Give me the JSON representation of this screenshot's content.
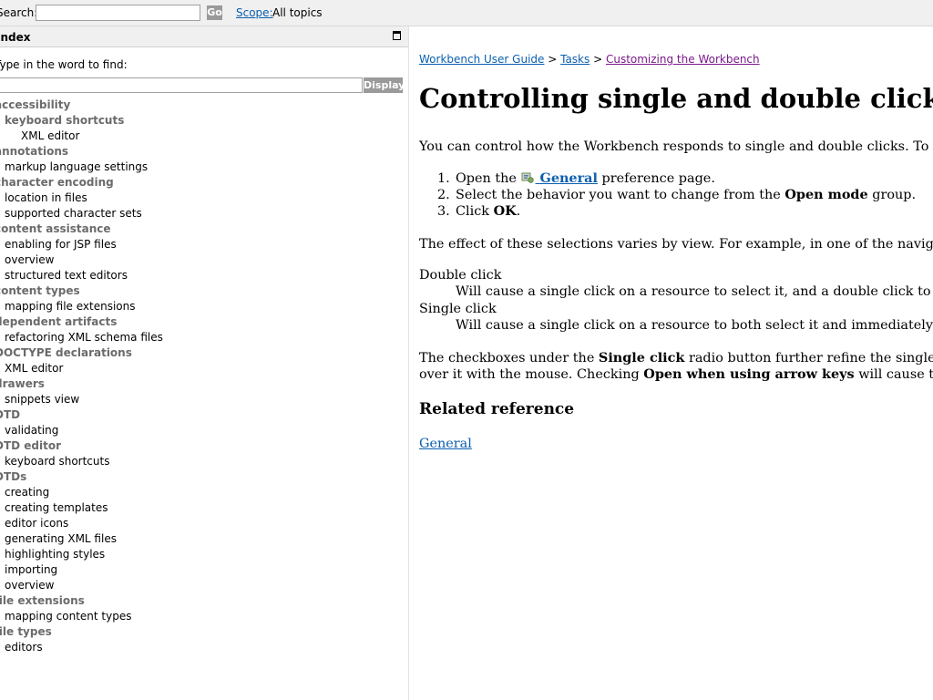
{
  "topbar": {
    "search_label": "Search:",
    "search_value": "",
    "go_label": "Go",
    "scope_link": "Scope:",
    "scope_value": "All topics"
  },
  "index": {
    "title": "Index",
    "find_label": "Type in the word to find:",
    "find_value": "",
    "display_label": "Display",
    "items": [
      {
        "text": "accessibility",
        "level": 0
      },
      {
        "text": "keyboard shortcuts",
        "level": 1,
        "bold": true
      },
      {
        "text": "XML editor",
        "level": 2
      },
      {
        "text": "annotations",
        "level": 0
      },
      {
        "text": "markup language settings",
        "level": 1
      },
      {
        "text": "character encoding",
        "level": 0
      },
      {
        "text": "location in files",
        "level": 1
      },
      {
        "text": "supported character sets",
        "level": 1
      },
      {
        "text": "content assistance",
        "level": 0
      },
      {
        "text": "enabling for JSP files",
        "level": 1
      },
      {
        "text": "overview",
        "level": 1
      },
      {
        "text": "structured text editors",
        "level": 1
      },
      {
        "text": "content types",
        "level": 0
      },
      {
        "text": "mapping file extensions",
        "level": 1
      },
      {
        "text": "dependent artifacts",
        "level": 0
      },
      {
        "text": "refactoring XML schema files",
        "level": 1
      },
      {
        "text": "DOCTYPE declarations",
        "level": 0
      },
      {
        "text": "XML editor",
        "level": 1
      },
      {
        "text": "drawers",
        "level": 0
      },
      {
        "text": "snippets view",
        "level": 1
      },
      {
        "text": "DTD",
        "level": 0
      },
      {
        "text": "validating",
        "level": 1
      },
      {
        "text": "DTD editor",
        "level": 0
      },
      {
        "text": "keyboard shortcuts",
        "level": 1
      },
      {
        "text": "DTDs",
        "level": 0
      },
      {
        "text": "creating",
        "level": 1
      },
      {
        "text": "creating templates",
        "level": 1
      },
      {
        "text": "editor icons",
        "level": 1
      },
      {
        "text": "generating XML files",
        "level": 1
      },
      {
        "text": "highlighting styles",
        "level": 1
      },
      {
        "text": "importing",
        "level": 1
      },
      {
        "text": "overview",
        "level": 1
      },
      {
        "text": "file extensions",
        "level": 0
      },
      {
        "text": "mapping content types",
        "level": 1
      },
      {
        "text": "file types",
        "level": 0
      },
      {
        "text": "editors",
        "level": 1
      }
    ]
  },
  "content": {
    "breadcrumb": {
      "crumb1": "Workbench User Guide",
      "sep1": " > ",
      "crumb2": "Tasks",
      "sep2": " > ",
      "crumb3": "Customizing the Workbench"
    },
    "title": "Controlling single and double click behavior",
    "intro": "You can control how the Workbench responds to single and double clicks. To do this:",
    "steps": {
      "s1_num": "1.",
      "s1_pre": "Open the ",
      "s1_link": " General",
      "s1_post": " preference page.",
      "s2_num": "2.",
      "s2_pre": "Select the behavior you want to change from the ",
      "s2_bold": "Open mode",
      "s2_post": " group.",
      "s3_num": "3.",
      "s3_pre": "Click ",
      "s3_bold": "OK",
      "s3_post": "."
    },
    "effect": "The effect of these selections varies by view. For example, in one of the navigation views:",
    "double_click_term": "Double click",
    "double_click_def": "Will cause a single click on a resource to select it, and a double click to open it in an editor.",
    "single_click_term": "Single click",
    "single_click_def": "Will cause a single click on a resource to both select it and immediately open an editor.",
    "checkbox": {
      "p1_pre": "The checkboxes under the ",
      "p1_bold": "Single click",
      "p1_post": " radio button further refine the single click behavior. Checking",
      "p2_pre": "over it with the mouse. Checking ",
      "p2_bold": "Open when using arrow keys",
      "p2_post": " will cause the resource to open"
    },
    "related_heading": "Related reference",
    "related_link": "General"
  }
}
